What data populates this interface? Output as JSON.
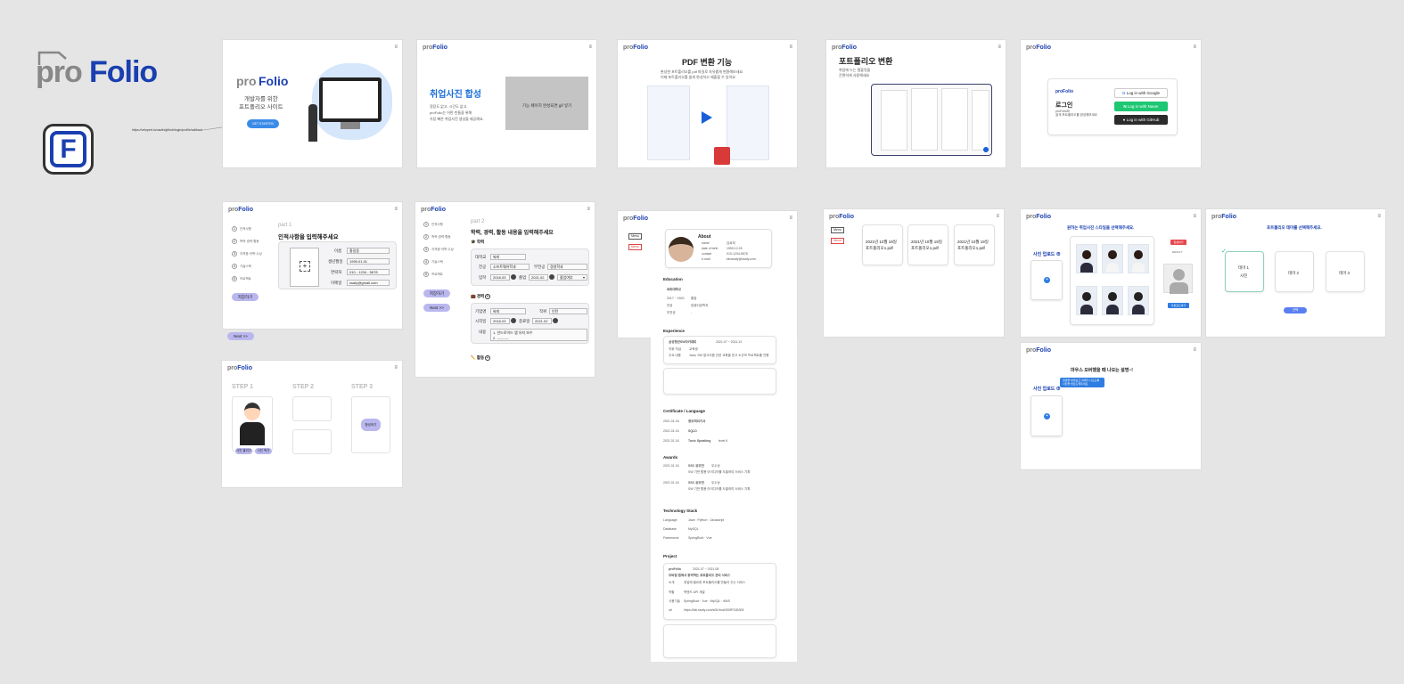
{
  "brand": {
    "logo_pro": "pro",
    "logo_folio": "Folio",
    "app_icon_letter": "F",
    "url_annotation": "https://velopert.io/oauth/github/login/profile/callback",
    "colors": {
      "accent": "#1a3fb0",
      "purple": "#b9b7ee",
      "blue": "#2f7de1",
      "green": "#1ec773"
    }
  },
  "common": {
    "menu_icon": "≡",
    "mini_logo_pro": "pro",
    "mini_logo_folio": "Folio"
  },
  "landing": {
    "logo_pro": "pro",
    "logo_folio": "Folio",
    "subtitle1": "개발자를 위한",
    "subtitle2": "포트폴리오 사이트",
    "cta": "GET STARTED"
  },
  "photo_feature": {
    "title": "취업사진 합성",
    "desc1": "정장도 없고, 시간도 없고,",
    "desc2": "proFolio는 어떤 빈틈을 위해",
    "desc3": "가장 빠른 취업사진 생성을 제공해요.",
    "gif_placeholder": "기능 페이지 완성되면 gif 넣기"
  },
  "pdf_feature": {
    "title": "PDF 변환 기능",
    "desc1": "완성한 포트폴리오를 pdf 파일로 자유롭게 변환해보세요.",
    "desc2": "이제 포트폴리오를 쉽게 완성하고 제출할 수 있어요."
  },
  "portfolio_convert": {
    "title": "포트폴리오 변환",
    "desc1": "취업에 드는 템플릿을",
    "desc2": "간편하게 사용해세요"
  },
  "login": {
    "brand": "proFolio",
    "title": "로그인",
    "subtitle1": "proFolio와",
    "subtitle2": "쉽게 포트폴리오를 완성해보세요",
    "google": "Log in with Google",
    "naver": "Log in with Naver",
    "github": "Log in with GitHub"
  },
  "part1": {
    "part": "part 1",
    "title": "인적사항을 입력해주세요",
    "steps": [
      "인적사항",
      "학력·경력·활동",
      "자격증·어학·수상",
      "기술스택",
      "프로젝트"
    ],
    "fields": [
      {
        "label": "이름",
        "value": "홍길동"
      },
      {
        "label": "생년월일",
        "value": "1999.01.01"
      },
      {
        "label": "연락처",
        "value": "010 - 1234 - 5678"
      },
      {
        "label": "이메일",
        "value": "ssafy@gmail.com"
      }
    ],
    "save": "저장하기",
    "next": "Next >>"
  },
  "part2": {
    "part": "part 2",
    "title": "학력, 경력, 활동 내용을 입력해주세요",
    "steps": [
      "인적사항",
      "학력·경력·활동",
      "자격증·어학·수상",
      "기술스택",
      "프로젝트"
    ],
    "edu_label": "🎓 학력",
    "school_label": "대학교",
    "school_value": "싸피",
    "major_label": "전공",
    "major_value": "소프트웨어학과",
    "minor_label": "부전공",
    "minor_value": "경영학과",
    "enter_label": "입학",
    "enter_value": "2016.03",
    "grad_label": "졸업",
    "grad_value": "2021.02",
    "grad_status": "졸업여부",
    "career_label": "💼 경력",
    "company_label": "기업명",
    "company_value": "싸피",
    "position_label": "직위",
    "position_value": "인턴",
    "start_label": "시작일",
    "start_value": "2016.03",
    "end_label": "종료일",
    "end_value": "2021.02",
    "content_label": "내용",
    "content_1": "1. 안드로이드 앱 유지 보수",
    "content_2": "2. ----------",
    "activity_label": "✏️ 활동",
    "save": "저장하기",
    "next": "Next >>"
  },
  "steps_page": {
    "step1": "STEP 1",
    "step2": "STEP 2",
    "step3": "STEP 3",
    "btn_upload": "사진 올리기",
    "btn_take": "사진 찍기",
    "btn_make": "합성하기"
  },
  "resume": {
    "tag1": "Menu",
    "tag2": "Menu",
    "about": "About",
    "about_rows": [
      [
        "name",
        "김싸피"
      ],
      [
        "date of birth",
        "1999.12.25"
      ],
      [
        "contact",
        "010-1234-5678"
      ],
      [
        "e-mail",
        "kimssafy@ssafy.com"
      ]
    ],
    "education": "Education",
    "edu_school": "싸피대학교",
    "edu_rows": [
      [
        "2017 ~ 2020",
        "졸업"
      ],
      [
        "전공",
        "컴퓨터공학과"
      ],
      [
        "부전공",
        "-"
      ]
    ],
    "experience": "Experience",
    "exp_company": "삼성청년SW아카데미",
    "exp_period": "2021.07 ~ 2021.12",
    "exp_rows": [
      [
        "직위·직급",
        "교육생"
      ],
      [
        "주요 내용",
        "Java, SW 알고리즘 관련 교육을 받고 소규모 프로젝트를 진행"
      ]
    ],
    "certificate": "Certificate / Language",
    "cert_rows": [
      [
        "2021.01.16",
        "정보처리기사"
      ],
      [
        "2021.01.16",
        "SQLD"
      ],
      [
        "2021.01.16",
        "Toeic Speaking",
        "level 6"
      ]
    ],
    "awards": "Awards",
    "award_rows": [
      [
        "2021.01.16",
        "SSC 공모전",
        "우수상"
      ],
      [
        "2021.01.16",
        "SSC 공모전",
        "우수상"
      ]
    ],
    "award_desc": "SW 기반 활용 아이디어를 도출하여 서비스 기획",
    "tech": "Technology Stack",
    "tech_rows": [
      [
        "Language",
        "Java · Python · Javascript"
      ],
      [
        "Database",
        "MySQL"
      ],
      [
        "Framework",
        "SpringBoot · Vue"
      ]
    ],
    "project": "Project",
    "proj_brand": "proFolio",
    "proj_period": "2021.07 ~ 2021.08",
    "proj_title": "모바일 앱에서 동작하는 포트폴리오 관리 서비스",
    "proj_rows": [
      [
        "소개",
        "취업에 필요한 포트폴리오를 만들어 주는 서비스"
      ],
      [
        "역할",
        "백엔드 API 개발"
      ],
      [
        "사용기술",
        "SpringBoot · Vue · MySQL · AWS"
      ],
      [
        "url",
        "https://lab.ssafy.com/s05-final/S05P31B305"
      ]
    ]
  },
  "pdf_list": {
    "tag1": "Menu",
    "tag2": "Menu",
    "files": [
      [
        "2021년 10월 19일",
        "포트폴리오1.pdf"
      ],
      [
        "2021년 10월 19일",
        "포트폴리오1.pdf"
      ],
      [
        "2021년 10월 19일",
        "포트폴리오1.pdf"
      ]
    ]
  },
  "style_select": {
    "title": "원하는 취업사진 스타일을 선택해주세요.",
    "upload": "사진 업로드 ⊕",
    "result_label": "RESULT",
    "btn_top": "합성하기",
    "btn_bottom": "다운로드하기"
  },
  "theme_select": {
    "title": "포트폴리오 테마를 선택해주세요.",
    "themes": [
      [
        "테마 1",
        "사진"
      ],
      [
        "테마 2",
        ""
      ],
      [
        "테마 3",
        ""
      ]
    ],
    "confirm": "선택"
  },
  "hover_page": {
    "title": "마우스 오버했을 때 나오는 설명~!",
    "tooltip1": "정면을 바라보고 어깨가 나오도록",
    "tooltip2": "사진을 업로드해주세요",
    "upload": "사진 업로드 ⊕"
  }
}
